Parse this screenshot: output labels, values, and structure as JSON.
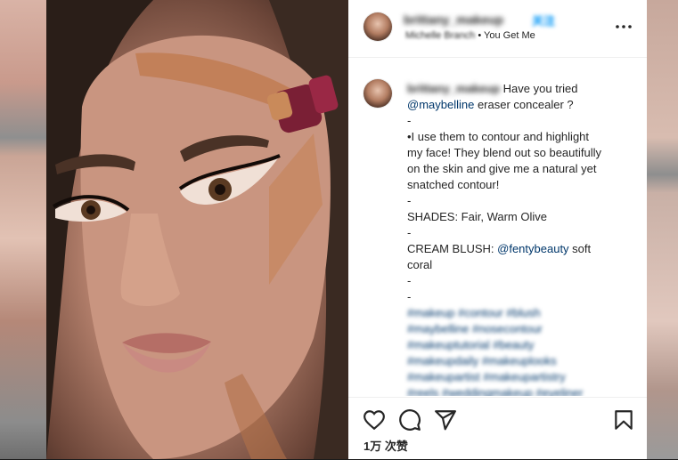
{
  "header": {
    "username": "brittany_makeup",
    "follow_label": "关注",
    "audio_artist": "Michelle Branch",
    "separator": "•",
    "audio_title": "You Get Me"
  },
  "caption": {
    "username": "brittany_makeup",
    "lines": [
      {
        "text": "Have you tried"
      },
      {
        "mention": "@maybelline",
        "text": " eraser concealer ?"
      },
      {
        "text": "-"
      },
      {
        "text": "•I use them to contour and highlight"
      },
      {
        "text": "my face! They blend out so beautifully"
      },
      {
        "text": "on the skin and give me a natural yet"
      },
      {
        "text": "snatched contour!"
      },
      {
        "text": "-"
      },
      {
        "text": "SHADES: Fair, Warm Olive"
      },
      {
        "text": "-"
      },
      {
        "text": "CREAM BLUSH: ",
        "mention": "@fentybeauty",
        "after": " soft"
      },
      {
        "text": "coral"
      },
      {
        "text": "-"
      },
      {
        "text": "-"
      }
    ],
    "hashtags": [
      "#makeup #contour #blush",
      "#maybelline #nosecontour",
      "#makeuptutorial #beauty",
      "#makeupdaily #makeuplooks",
      "#makeupartist #makeupartistry",
      "#reels #weddingmakeup #eyeliner"
    ]
  },
  "actions": {
    "like_icon": "heart-icon",
    "comment_icon": "comment-icon",
    "share_icon": "send-icon",
    "save_icon": "bookmark-icon",
    "likes_text": "1万 次赞"
  },
  "colors": {
    "link": "#00376b",
    "follow": "#0095f6",
    "text": "#262626",
    "border": "#efefef"
  }
}
